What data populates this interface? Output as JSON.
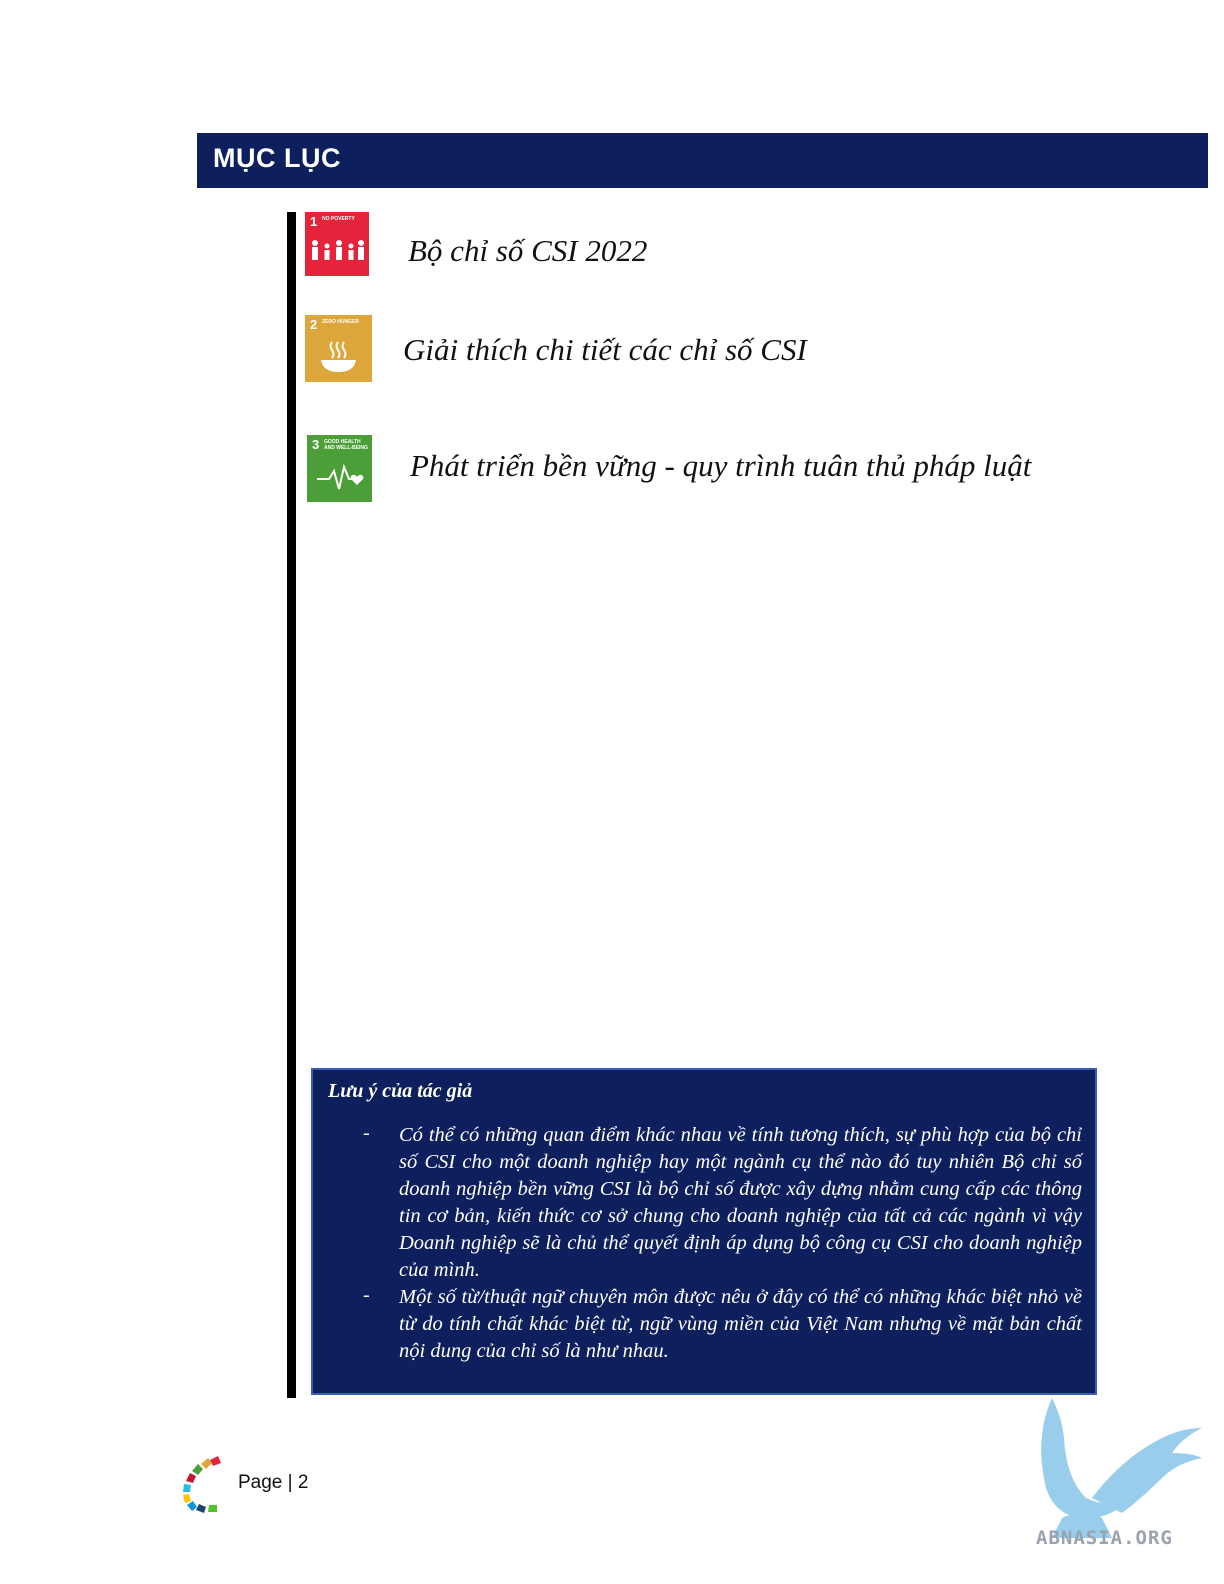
{
  "header": {
    "title": "MỤC LỤC"
  },
  "sdg_icons": [
    {
      "number": "1",
      "caption": "NO POVERTY",
      "color": "#e5243b",
      "icon": "family-icon"
    },
    {
      "number": "2",
      "caption": "ZERO HUNGER",
      "color": "#dda63a",
      "icon": "bowl-icon"
    },
    {
      "number": "3",
      "caption": "GOOD HEALTH AND WELL-BEING",
      "color": "#4c9f38",
      "icon": "heartbeat-icon"
    }
  ],
  "toc": [
    {
      "label": "Bộ chỉ số CSI 2022"
    },
    {
      "label": "Giải thích chi tiết các chỉ số CSI"
    },
    {
      "label": "Phát triển bền vững - quy trình tuân thủ pháp luật"
    }
  ],
  "note": {
    "title": "Lưu ý của tác giả",
    "items": [
      {
        "dash": "-",
        "text": "Có thể có những quan điểm khác nhau về tính tương thích, sự phù hợp của bộ chỉ số CSI cho một doanh nghiệp hay một ngành cụ thể nào đó tuy nhiên Bộ chỉ số doanh nghiệp bền vững CSI là bộ chỉ số được xây dựng nhằm cung cấp các thông tin cơ bản, kiến thức cơ sở chung cho doanh nghiệp của tất cả các ngành vì vậy Doanh nghiệp sẽ là chủ thể quyết định áp dụng bộ công cụ CSI cho doanh nghiệp của mình."
      },
      {
        "dash": "-",
        "text": "Một số từ/thuật ngữ chuyên môn được nêu ở đây có thể có những khác biệt nhỏ về từ do tính chất khác biệt từ, ngữ vùng miền của Việt Nam nhưng về mặt bản chất nội dung của chỉ số là như nhau."
      }
    ]
  },
  "footer": {
    "page_label": "Page | 2"
  },
  "watermark": {
    "text": "ABNASIA.ORG"
  },
  "colors": {
    "navy": "#0d1f5c",
    "border": "#3b5fb0"
  }
}
